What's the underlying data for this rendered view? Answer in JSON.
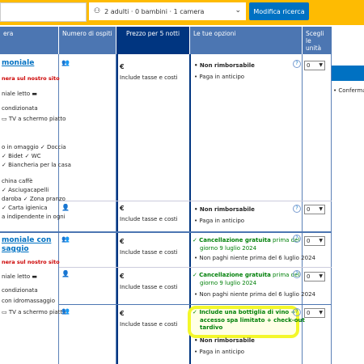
{
  "search": {
    "guests": "2 adulti · 0 bambini · 1 camera",
    "button": "Modifica ricerca"
  },
  "headers": {
    "room": "era",
    "guests": "Numero di ospiti",
    "price": "Prezzo per 5 notti",
    "options": "Le tue opzioni",
    "choose1": "Scegli",
    "choose2": "le",
    "choose3": "unità"
  },
  "room1": {
    "title": "moniale",
    "promo": "nera sul nostro sito",
    "bed": "niale letto",
    "f1": "condizionata",
    "f2": "TV a schermo piatto",
    "f3": "o in omaggio",
    "f4": "Doccia",
    "f5": "Bidet",
    "f6": "WC",
    "f7": "Biancheria per la casa",
    "f8": "china caffè",
    "f9": "Asciugacapelli",
    "f10": "daroba",
    "f11": "Zona pranzo",
    "f12": "Carta igienica",
    "f13": "a indipendente in ogni"
  },
  "room2": {
    "title1": "moniale con",
    "title2": "saggio",
    "promo": "nera sul nostro sito",
    "bed": "niale letto",
    "f1": "condizionata",
    "f2": "con idromassaggio",
    "f3": "TV a schermo piatto"
  },
  "rows": [
    {
      "currency": "€",
      "tax": "Include tasse e costi",
      "o1": "Non rimborsabile",
      "o2": "Paga in anticipo",
      "qty": "0"
    },
    {
      "currency": "€",
      "tax": "Include tasse e costi",
      "o1": "Non rimborsabile",
      "o2": "Paga in anticipo",
      "qty": "0"
    },
    {
      "currency": "€",
      "tax": "Include tasse e costi",
      "o1a": "Cancellazione gratuita",
      "o1b": "prima del",
      "o1c": "giorno 9 luglio 2024",
      "o2": "Non paghi niente prima del 6 luglio 2024",
      "qty": "0"
    },
    {
      "currency": "€",
      "tax": "Include tasse e costi",
      "o1a": "Cancellazione gratuita",
      "o1b": "prima del",
      "o1c": "giorno 9 luglio 2024",
      "o2": "Non paghi niente prima del 6 luglio 2024",
      "qty": "0"
    },
    {
      "currency": "€",
      "tax": "Include tasse e costi",
      "o0a": "Include una bottiglia di vino +",
      "o0b": "accesso spa limitato + check-out",
      "o0c": "tardivo",
      "o1": "Non rimborsabile",
      "o2": "Paga in anticipo",
      "qty": "0"
    }
  ],
  "confirm": "Conferma",
  "colors": {
    "accent": "#0071c2",
    "header": "#4c76b2",
    "header_dark": "#003580",
    "search_bar": "#febb02",
    "highlight": "#f3f72a"
  }
}
